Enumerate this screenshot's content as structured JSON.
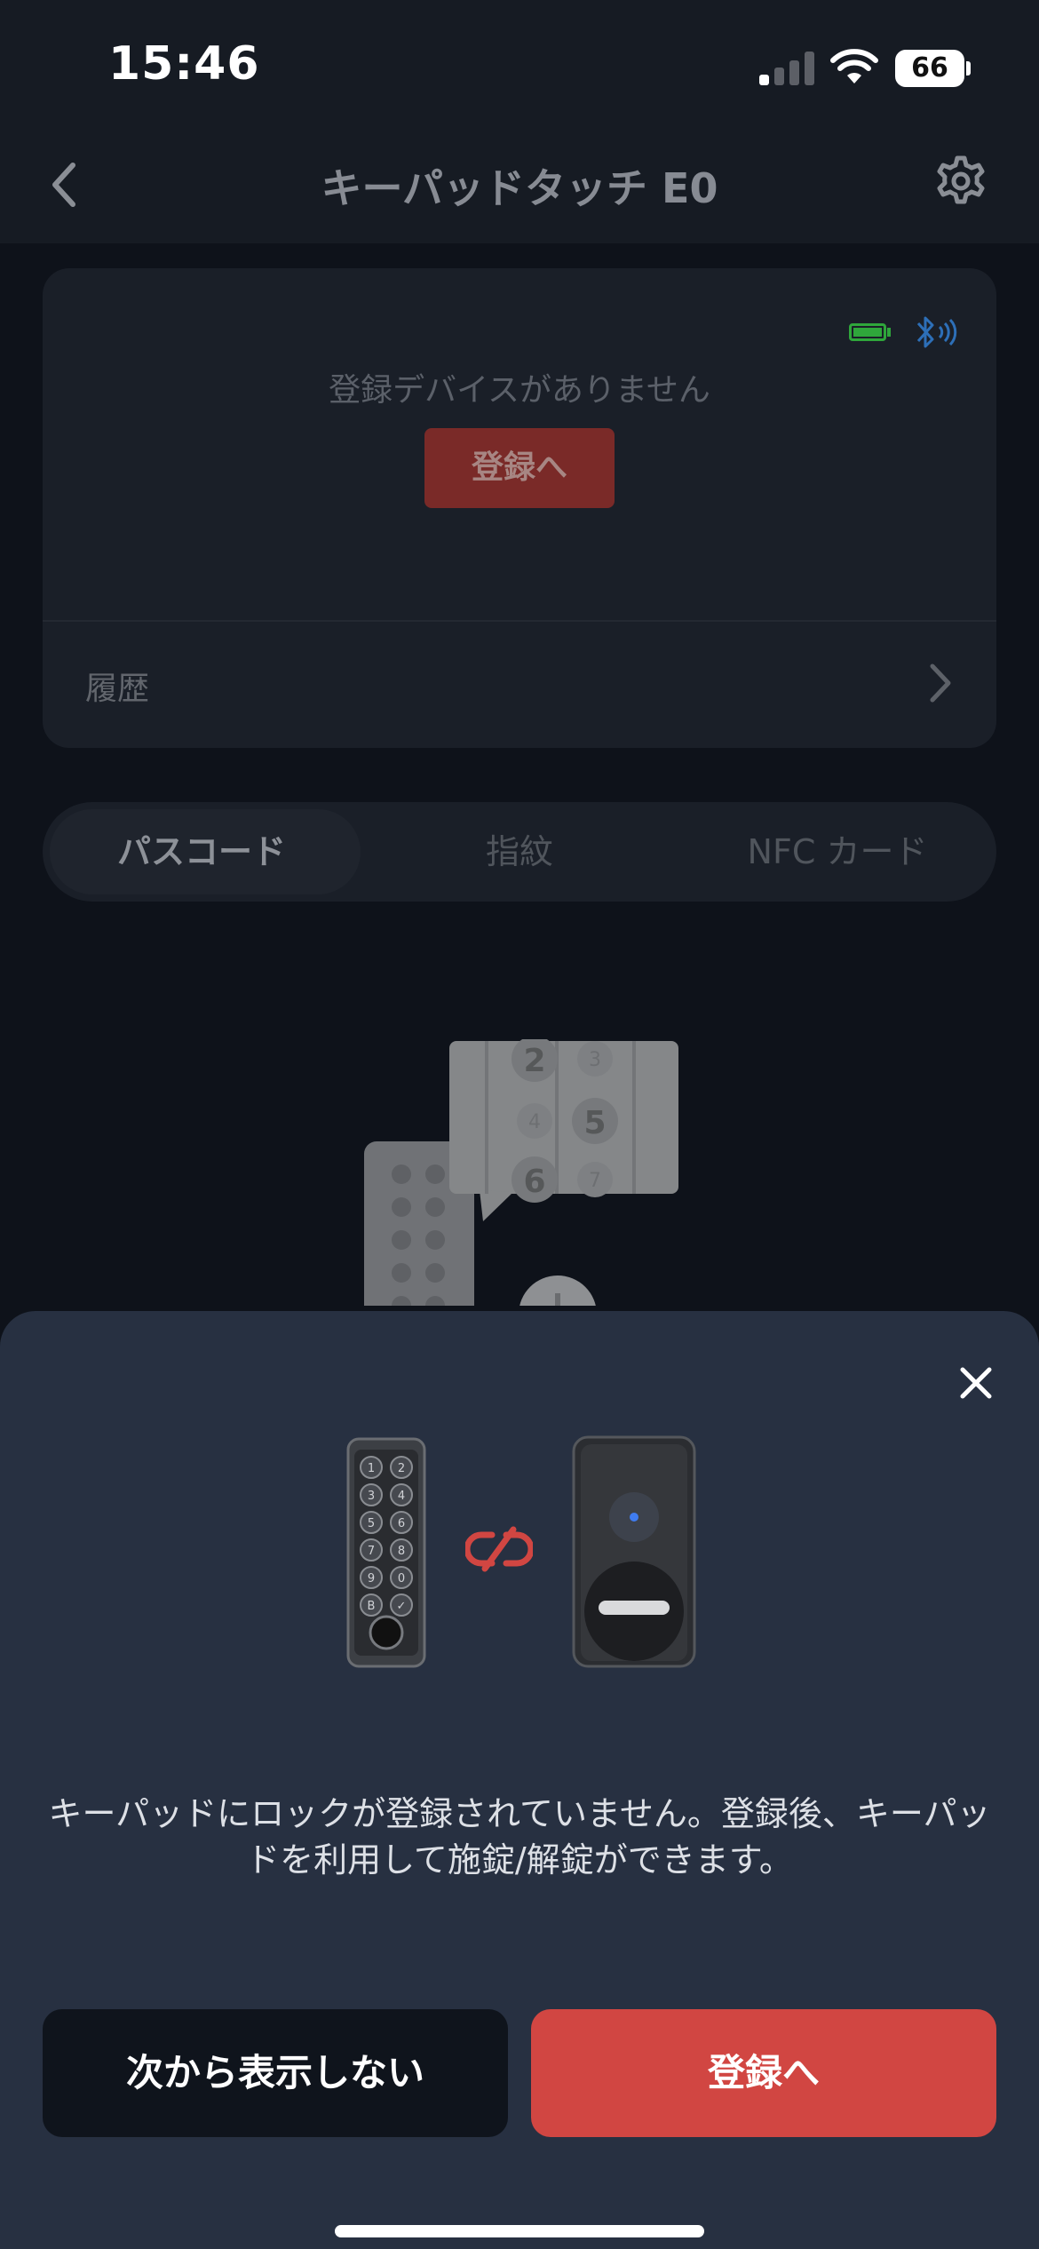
{
  "status_bar": {
    "time": "15:46",
    "battery_level": "66",
    "cellular_bars_active": 1,
    "cellular_bars_total": 4
  },
  "nav": {
    "title": "キーパッドタッチ E0",
    "back_icon": "chevron-left-icon",
    "settings_icon": "gear-icon"
  },
  "device_card": {
    "empty_text": "登録デバイスがありません",
    "register_label": "登録へ",
    "history_label": "履歴",
    "battery_color": "#2fa63b",
    "bluetooth_color": "#2d6fb8"
  },
  "tabs": [
    {
      "label": "パスコード",
      "active": true
    },
    {
      "label": "指紋",
      "active": false
    },
    {
      "label": "NFC カード",
      "active": false
    }
  ],
  "illustration_digits": [
    "2",
    "3",
    "4",
    "5",
    "6",
    "7"
  ],
  "sheet": {
    "message": "キーパッドにロックが登録されていません。登録後、キーパッドを利用して施錠/解錠ができます。",
    "dismiss_label": "次から表示しない",
    "register_label": "登録へ",
    "accent": "#d14642",
    "keypad_keys": [
      "1",
      "2",
      "3",
      "4",
      "5",
      "6",
      "7",
      "8",
      "9",
      "0",
      "B",
      "✓"
    ]
  }
}
